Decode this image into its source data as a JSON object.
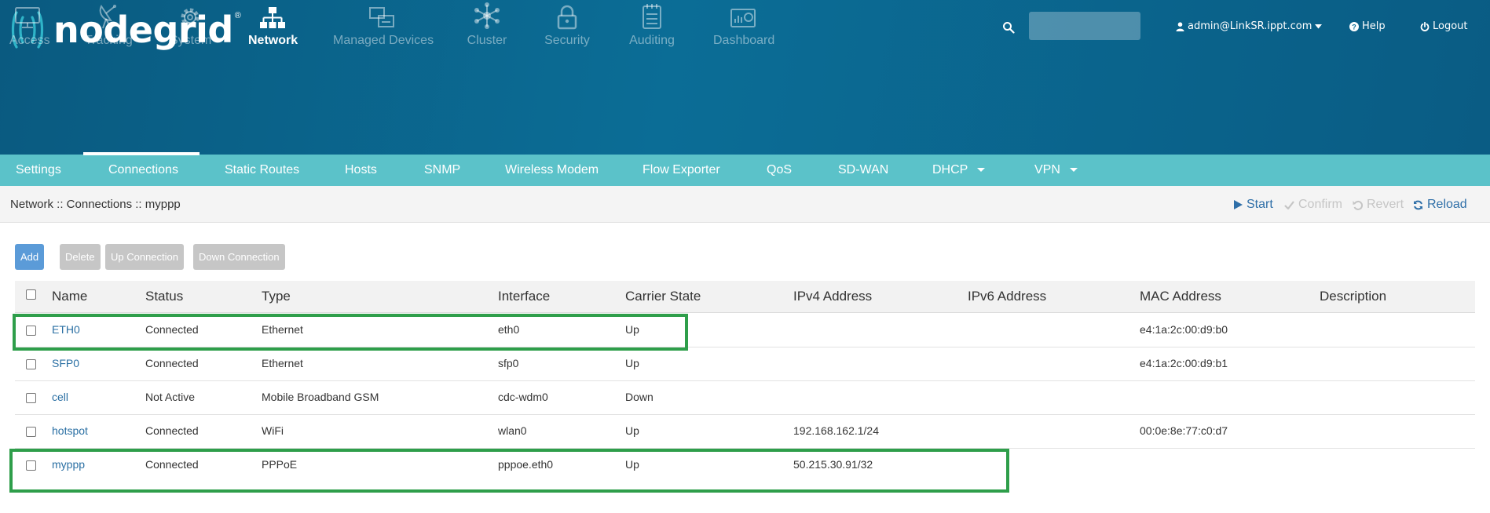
{
  "header": {
    "logo_text": "nodegrid",
    "logo_reg": "®",
    "user_label": "admin@LinkSR.ippt.com",
    "help_label": "Help",
    "logout_label": "Logout",
    "search": {
      "value": "",
      "placeholder": ""
    }
  },
  "nav": {
    "items": [
      {
        "label": "Access",
        "icon": "monitor-icon",
        "active": false
      },
      {
        "label": "Tracking",
        "icon": "satellite-dish-icon",
        "active": false
      },
      {
        "label": "System",
        "icon": "gear-icon",
        "active": false
      },
      {
        "label": "Network",
        "icon": "network-tree-icon",
        "active": true
      },
      {
        "label": "Managed Devices",
        "icon": "devices-icon",
        "active": false
      },
      {
        "label": "Cluster",
        "icon": "cluster-icon",
        "active": false
      },
      {
        "label": "Security",
        "icon": "lock-icon",
        "active": false
      },
      {
        "label": "Auditing",
        "icon": "notepad-icon",
        "active": false
      },
      {
        "label": "Dashboard",
        "icon": "dashboard-icon",
        "active": false
      }
    ]
  },
  "subnav": {
    "items": [
      {
        "label": "Settings"
      },
      {
        "label": "Connections",
        "active": true
      },
      {
        "label": "Static Routes"
      },
      {
        "label": "Hosts"
      },
      {
        "label": "SNMP"
      },
      {
        "label": "Wireless Modem"
      },
      {
        "label": "Flow Exporter"
      },
      {
        "label": "QoS"
      },
      {
        "label": "SD-WAN"
      },
      {
        "label": "DHCP",
        "dropdown": true
      },
      {
        "label": "VPN",
        "dropdown": true
      }
    ]
  },
  "breadcrumb": "Network :: Connections :: myppp",
  "actions": {
    "start": "Start",
    "confirm": "Confirm",
    "revert": "Revert",
    "reload": "Reload"
  },
  "toolbar": {
    "add": "Add",
    "delete": "Delete",
    "up": "Up Connection",
    "down": "Down Connection"
  },
  "table": {
    "columns": [
      "Name",
      "Status",
      "Type",
      "Interface",
      "Carrier State",
      "IPv4 Address",
      "IPv6 Address",
      "MAC Address",
      "Description"
    ],
    "rows": [
      {
        "name": "ETH0",
        "status": "Connected",
        "type": "Ethernet",
        "interface": "eth0",
        "carrier": "Up",
        "ipv4": "",
        "ipv6": "",
        "mac": "e4:1a:2c:00:d9:b0",
        "description": ""
      },
      {
        "name": "SFP0",
        "status": "Connected",
        "type": "Ethernet",
        "interface": "sfp0",
        "carrier": "Up",
        "ipv4": "",
        "ipv6": "",
        "mac": "e4:1a:2c:00:d9:b1",
        "description": ""
      },
      {
        "name": "cell",
        "status": "Not Active",
        "type": "Mobile Broadband GSM",
        "interface": "cdc-wdm0",
        "carrier": "Down",
        "ipv4": "",
        "ipv6": "",
        "mac": "",
        "description": ""
      },
      {
        "name": "hotspot",
        "status": "Connected",
        "type": "WiFi",
        "interface": "wlan0",
        "carrier": "Up",
        "ipv4": "192.168.162.1/24",
        "ipv6": "",
        "mac": "00:0e:8e:77:c0:d7",
        "description": ""
      },
      {
        "name": "myppp",
        "status": "Connected",
        "type": "PPPoE",
        "interface": "pppoe.eth0",
        "carrier": "Up",
        "ipv4": "50.215.30.91/32",
        "ipv6": "",
        "mac": "",
        "description": ""
      }
    ]
  },
  "colors": {
    "header_bg": "#0b6d96",
    "subnav_bg": "#5bc2c9",
    "link": "#2a6fa3",
    "primary_button": "#5b9bd8",
    "disabled_button": "#c6c6c6",
    "highlight": "#2e9e4a"
  }
}
